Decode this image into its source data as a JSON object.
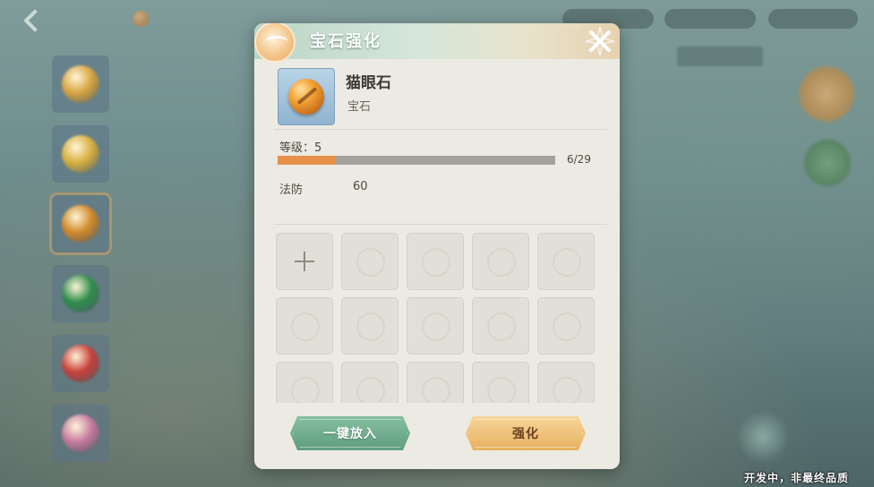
{
  "hud": {
    "back_icon": "back-arrow-icon",
    "title": "",
    "coin_icon": "coin-icon"
  },
  "gem_list": [
    {
      "color": "#d9a440",
      "active": false
    },
    {
      "color": "#d9b040",
      "active": false
    },
    {
      "color": "#d2892a",
      "active": true
    },
    {
      "color": "#2f8d4c",
      "active": false
    },
    {
      "color": "#c8403a",
      "active": false
    },
    {
      "color": "#c77aa0",
      "active": false
    }
  ],
  "dialog": {
    "title": "宝石强化",
    "close_icon": "close-x-icon",
    "item": {
      "name": "猫眼石",
      "type": "宝石",
      "icon": "amber-gem-icon"
    },
    "level_label": "等级：5",
    "progress": {
      "current": 6,
      "max": 29,
      "text": "6/29"
    },
    "stat": {
      "name": "法防",
      "value": "60"
    },
    "grid": {
      "add_icon": "plus-icon",
      "empty_slot_count": 14
    },
    "buttons": {
      "auto_fill": "一键放入",
      "enhance": "强化"
    }
  },
  "dev_note": "开发中，非最终品质",
  "colors": {
    "accent_orange": "#e7904a",
    "button_green": "#5e9d7e",
    "button_gold": "#e8b160",
    "panel_bg": "#ecebe3"
  }
}
